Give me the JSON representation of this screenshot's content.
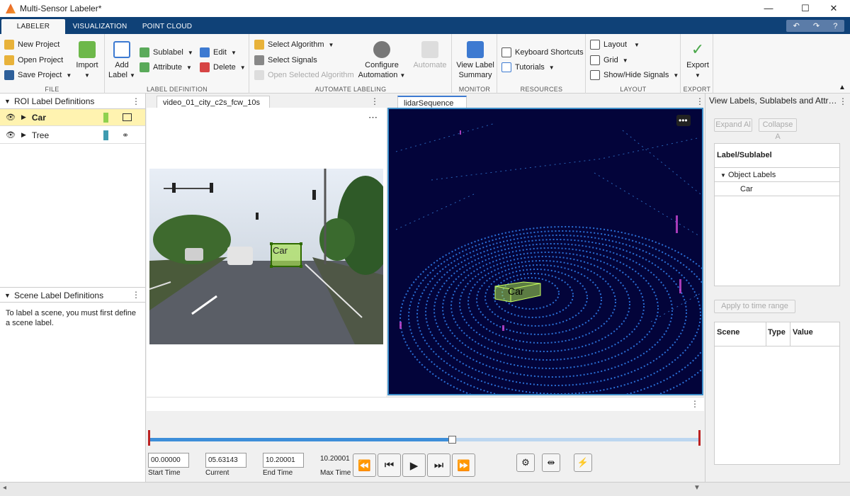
{
  "window": {
    "title": "Multi-Sensor Labeler*"
  },
  "tabs": [
    "LABELER",
    "VISUALIZATION",
    "POINT CLOUD"
  ],
  "ribbon": {
    "file": {
      "label": "FILE",
      "new": "New Project",
      "open": "Open Project",
      "save": "Save Project",
      "import": "Import"
    },
    "label_def": {
      "label": "LABEL DEFINITION",
      "add_label": "Add",
      "add_label2": "Label",
      "sublabel": "Sublabel",
      "attribute": "Attribute",
      "edit": "Edit",
      "delete": "Delete"
    },
    "automate": {
      "label": "AUTOMATE LABELING",
      "select_algorithm": "Select Algorithm",
      "select_signals": "Select Signals",
      "open_selected": "Open Selected Algorithm",
      "configure": "Configure",
      "configure2": "Automation",
      "automate": "Automate"
    },
    "monitor": {
      "label": "MONITOR",
      "view": "View Label",
      "view2": "Summary"
    },
    "resources": {
      "label": "RESOURCES",
      "shortcuts": "Keyboard Shortcuts",
      "tutorials": "Tutorials"
    },
    "layout": {
      "label": "LAYOUT",
      "layout": "Layout",
      "grid": "Grid",
      "showhide": "Show/Hide Signals"
    },
    "export": {
      "label": "EXPORT",
      "export": "Export"
    }
  },
  "roi": {
    "title": "ROI Label Definitions",
    "items": [
      {
        "name": "Car",
        "color": "#8fd14f"
      },
      {
        "name": "Tree",
        "color": "#3e9bb0"
      }
    ]
  },
  "scene": {
    "title": "Scene Label Definitions",
    "message": "To label a scene, you must first define a scene label."
  },
  "video": {
    "tab": "video_01_city_c2s_fcw_10s",
    "box_label": "Car"
  },
  "lidar": {
    "tab": "lidarSequence",
    "box_label": "Car"
  },
  "right": {
    "title": "View Labels, Sublabels and Attr…",
    "expand": "Expand Al",
    "collapse": "Collapse A",
    "col_header": "Label/Sublabel",
    "object_labels": "Object Labels",
    "car": "Car",
    "apply": "Apply to time range",
    "scene_col": "Scene",
    "type_col": "Type",
    "value_col": "Value"
  },
  "playback": {
    "start": "00.00000",
    "current": "05.63143",
    "end": "10.20001",
    "max": "10.20001",
    "start_label": "Start Time",
    "current_label": "Current",
    "end_label": "End Time",
    "max_label": "Max Time",
    "progress": 0.55
  },
  "colors": {
    "accent": "#0f4177",
    "selected": "#fff3b0",
    "bbox": "#a6e04a",
    "lidar_bg": "#03043a"
  }
}
